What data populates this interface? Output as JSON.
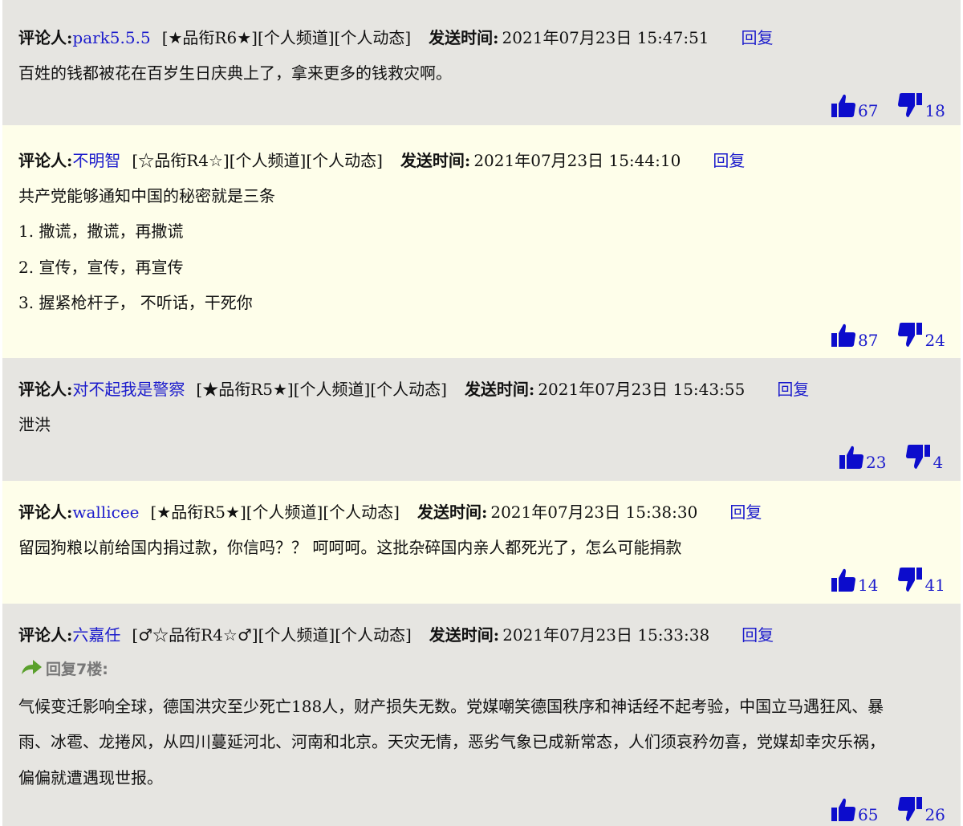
{
  "labels": {
    "commenter": "评论人:",
    "send_time": "发送时间:",
    "reply": "回复",
    "channel": "[个人频道]",
    "activity": "[个人动态]"
  },
  "comments": [
    {
      "user": "park5.5.5",
      "rank": "[★品衔R6★]",
      "time": "2021年07月23日 15:47:51",
      "body": [
        "百姓的钱都被花在百岁生日庆典上了，拿来更多的钱救灾啊。"
      ],
      "up": "67",
      "down": "18"
    },
    {
      "user": "不明智",
      "rank": "[☆品衔R4☆]",
      "time": "2021年07月23日 15:44:10",
      "body": [
        "共产党能够通知中国的秘密就是三条",
        "1. 撒谎，撒谎，再撒谎",
        "2. 宣传，宣传，再宣传",
        "3. 握紧枪杆子， 不听话，干死你"
      ],
      "up": "87",
      "down": "24"
    },
    {
      "user": "对不起我是警察",
      "rank": "[★品衔R5★]",
      "time": "2021年07月23日 15:43:55",
      "body": [
        "泄洪"
      ],
      "up": "23",
      "down": "4"
    },
    {
      "user": "wallicee",
      "rank": "[★品衔R5★]",
      "time": "2021年07月23日 15:38:30",
      "body": [
        "留园狗粮以前给国内捐过款，你信吗？？ 呵呵呵。这批杂碎国内亲人都死光了，怎么可能捐款"
      ],
      "up": "14",
      "down": "41"
    },
    {
      "user": "六嘉任",
      "rank": "[♂☆品衔R4☆♂]",
      "time": "2021年07月23日 15:33:38",
      "quote": "回复7楼:",
      "body": [
        "气候变迁影响全球，德国洪灾至少死亡188人，财产损失无数。党媒嘲笑德国秩序和神话经不起考验，中国立马遇狂风、暴",
        "雨、冰雹、龙捲风，从四川蔓延河北、河南和北京。天灾无情，恶劣气象已成新常态，人们须哀矜勿喜，党媒却幸灾乐祸，",
        "偏偏就遭遇现世报。"
      ],
      "up": "65",
      "down": "26"
    }
  ]
}
